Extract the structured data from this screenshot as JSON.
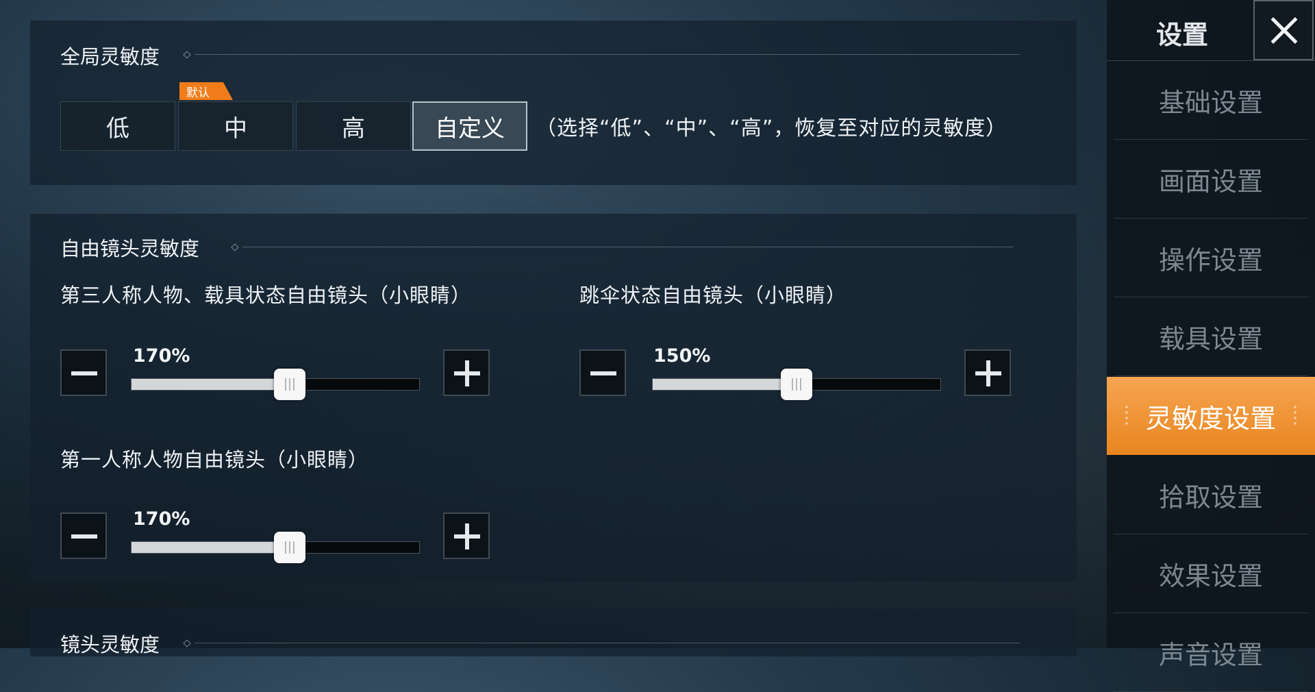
{
  "global": {
    "title": "全局灵敏度",
    "default_badge": "默认",
    "options": [
      "低",
      "中",
      "高",
      "自定义"
    ],
    "selected": "自定义",
    "hint": "（选择“低”、“中”、“高”，恢复至对应的灵敏度）"
  },
  "free_camera": {
    "title": "自由镜头灵敏度",
    "sliders": [
      {
        "label": "第三人称人物、载具状态自由镜头（小眼睛）",
        "value_text": "170%",
        "level": 0.55
      },
      {
        "label": "跳伞状态自由镜头（小眼睛）",
        "value_text": "150%",
        "level": 0.5
      },
      {
        "label": "第一人称人物自由镜头（小眼睛）",
        "value_text": "170%",
        "level": 0.55
      }
    ]
  },
  "lens": {
    "title": "镜头灵敏度"
  },
  "sidebar": {
    "title": "设置",
    "items": [
      {
        "label": "基础设置"
      },
      {
        "label": "画面设置"
      },
      {
        "label": "操作设置"
      },
      {
        "label": "载具设置"
      },
      {
        "label": "灵敏度设置",
        "active": true
      },
      {
        "label": "拾取设置"
      },
      {
        "label": "效果设置"
      },
      {
        "label": "声音设置"
      }
    ]
  },
  "colors": {
    "accent": "#f07d1a",
    "active_nav": "#ef9a3f"
  }
}
